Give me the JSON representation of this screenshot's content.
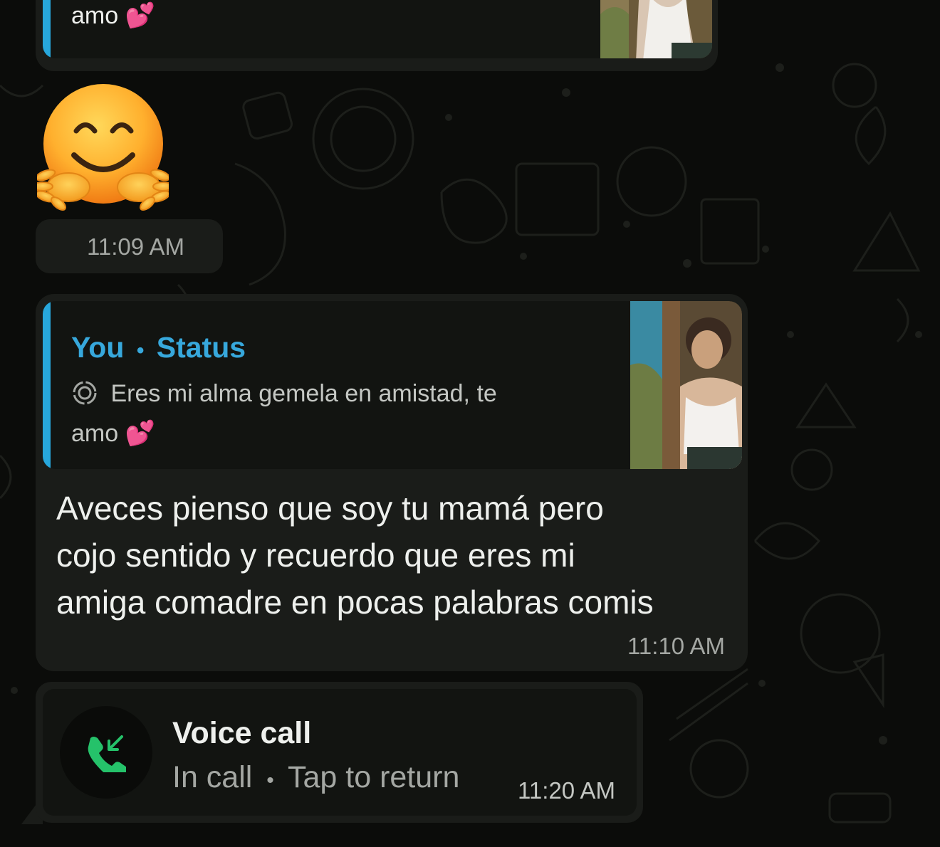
{
  "messages": {
    "top_quote": {
      "text_tail": "amo",
      "emoji": "💕"
    },
    "sticker": {
      "name": "hugging-face-emoji",
      "time": "11:09 AM"
    },
    "status_reply": {
      "quote_author": "You",
      "quote_separator": "•",
      "quote_type": "Status",
      "quote_text": "Eres mi alma gemela en amistad, te",
      "quote_text_line2": "amo",
      "quote_emoji": "💕",
      "body_line1": "Aveces pienso  que soy tu mamá pero",
      "body_line2": "cojo sentido y recuerdo que eres mi",
      "body_line3": "amiga comadre en pocas palabras  comis",
      "time": "11:10 AM"
    },
    "voice_call": {
      "title": "Voice call",
      "status": "In call",
      "separator": "•",
      "action": "Tap to return",
      "time": "11:20 AM"
    }
  },
  "colors": {
    "background": "#0b0c0a",
    "bubble": "#1a1c19",
    "quote_accent": "#27a7dc",
    "call_icon": "#25c26a"
  }
}
